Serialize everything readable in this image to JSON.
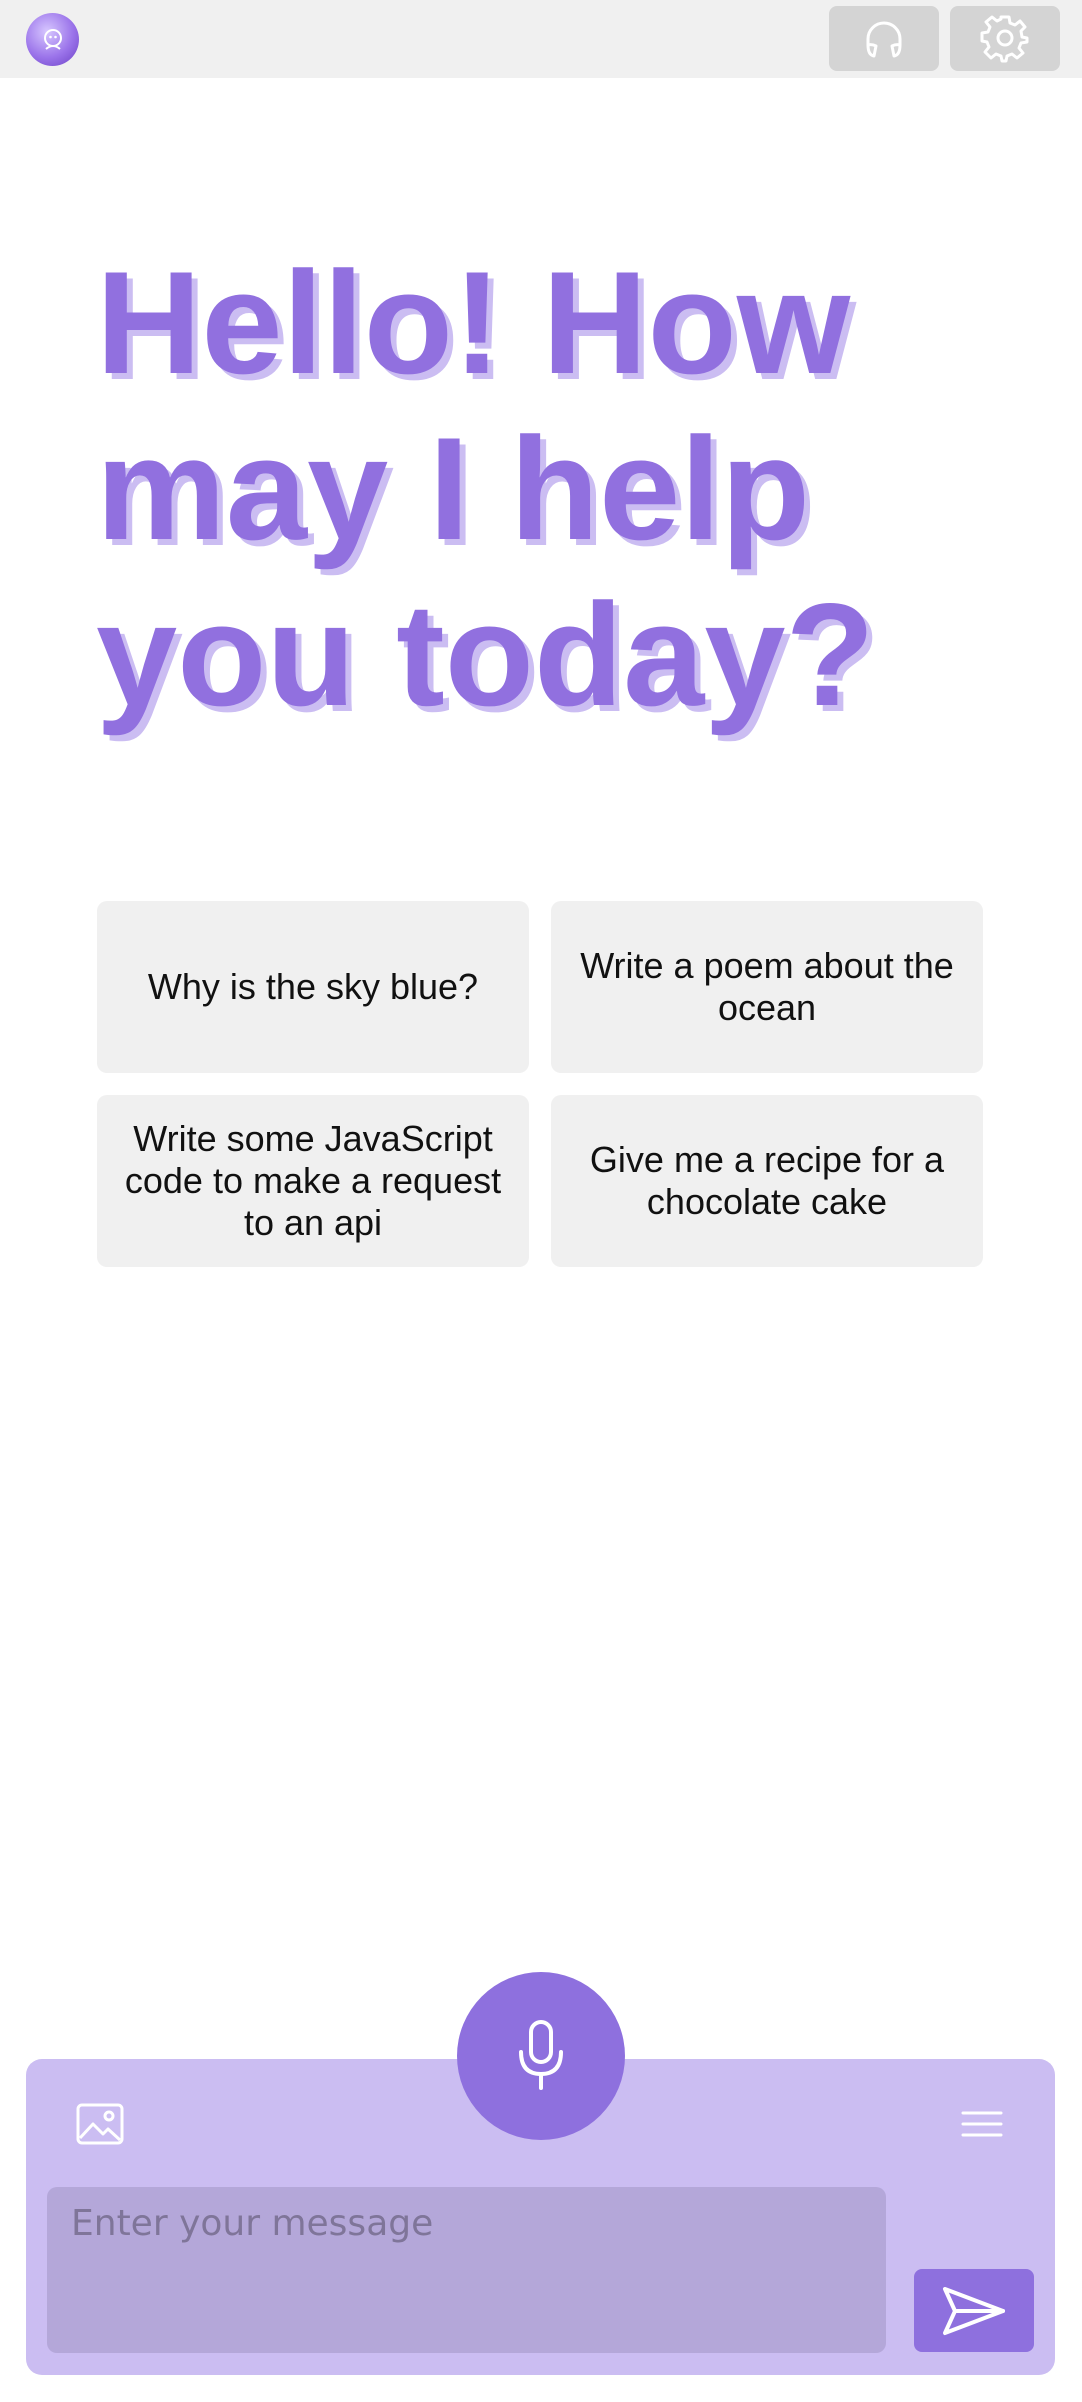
{
  "header": {
    "logo_icon": "assistant-face-icon",
    "headphones_icon": "headphones-icon",
    "settings_icon": "gear-icon"
  },
  "main": {
    "greeting": "Hello! How may I help you today?",
    "suggestions": [
      {
        "label": "Why is the sky blue?"
      },
      {
        "label": "Write a poem about the ocean"
      },
      {
        "label": "Write some JavaScript code to make a request to an api"
      },
      {
        "label": "Give me a recipe for a chocolate cake"
      }
    ]
  },
  "composer": {
    "placeholder": "Enter your message",
    "value": "",
    "mic_icon": "microphone-icon",
    "image_icon": "image-icon",
    "menu_icon": "menu-icon",
    "send_icon": "send-icon"
  },
  "colors": {
    "accent": "#8e70de",
    "greeting": "#9170df",
    "composer_bg": "#cbbdf2",
    "input_bg": "#b4a7d9",
    "topbar_bg": "#f0f0f0",
    "card_bg": "#f0f0f0"
  }
}
